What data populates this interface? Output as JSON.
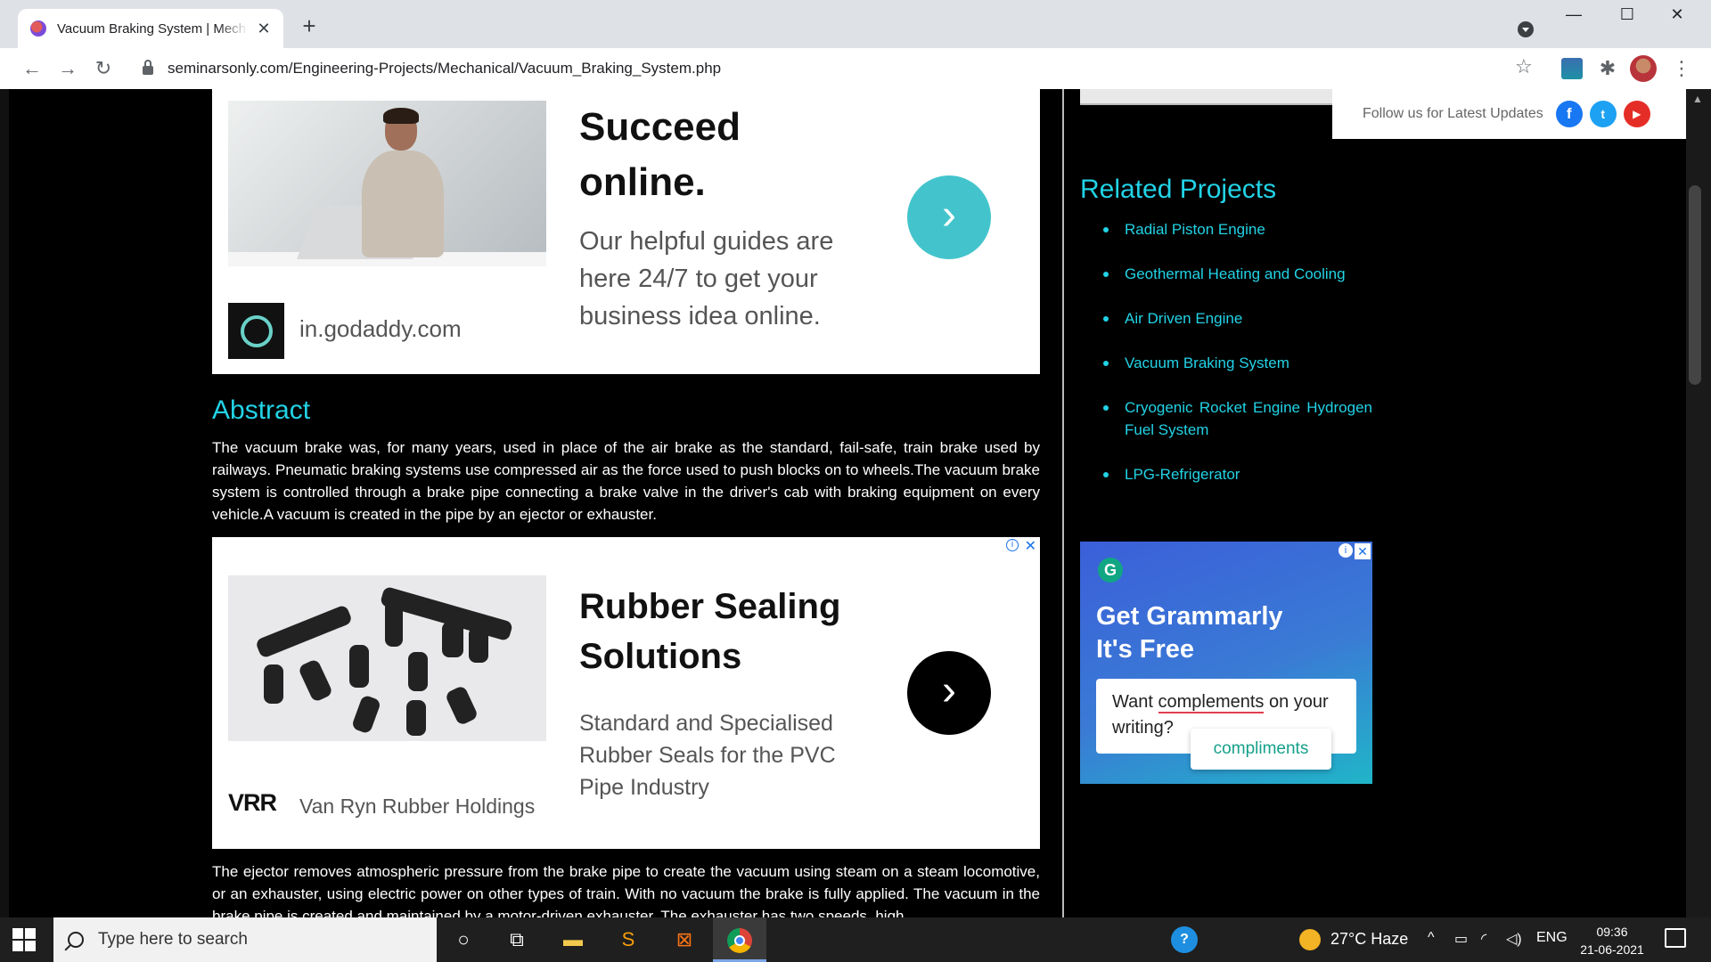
{
  "browser": {
    "tab_title": "Vacuum Braking System | Mechanical",
    "tab_close": "✕",
    "new_tab": "+",
    "url": "seminarsonly.com/Engineering-Projects/Mechanical/Vacuum_Braking_System.php",
    "window": {
      "minimize": "—",
      "maximize": "☐",
      "close": "✕"
    },
    "nav": {
      "back": "←",
      "forward": "→",
      "reload": "↻"
    },
    "star": "☆",
    "extensions": "✱",
    "menu": "⋮"
  },
  "ad_top": {
    "headline": "Succeed online.",
    "description": "Our helpful guides are here 24/7 to get your business idea online.",
    "domain": "in.godaddy.com",
    "cta": "›"
  },
  "abstract": {
    "title": "Abstract",
    "paragraph1": "The vacuum brake was, for many years, used in place of the air brake as the standard, fail-safe, train brake used by railways. Pneumatic braking systems use compressed air as the force used to push blocks on to wheels.The vacuum brake system is controlled through a brake pipe connecting a brake valve in the driver's cab with braking equipment on every vehicle.A vacuum is created in the pipe by an ejector or exhauster.",
    "paragraph2": "The ejector removes atmospheric pressure from the brake pipe to create the vacuum using steam on a steam locomotive, or an exhauster, using electric power on other types of train. With no vacuum the brake is fully applied. The vacuum in the brake pipe is created and maintained by a motor-driven exhauster. The exhauster has two speeds, high"
  },
  "ad_mid": {
    "headline": "Rubber Sealing Solutions",
    "description": "Standard and Specialised Rubber Seals for the PVC Pipe Industry",
    "logo": "VRR",
    "advertiser": "Van Ryn Rubber Holdings",
    "cta": "›",
    "adchoice": "i",
    "close": "✕"
  },
  "sidebar": {
    "follow_label": "Follow us for Latest Updates",
    "social": {
      "facebook": "f",
      "twitter": "t",
      "youtube": "▶"
    },
    "related_title": "Related Projects",
    "related": [
      "Radial Piston Engine",
      "Geothermal Heating and Cooling",
      "Air Driven Engine",
      "Vacuum Braking System",
      "Cryogenic Rocket Engine Hydrogen Fuel System",
      "LPG-Refrigerator"
    ]
  },
  "grammarly_ad": {
    "logo": "G",
    "title_line1": "Get Grammarly",
    "title_line2": "It's Free",
    "card_prefix": "Want ",
    "card_word": "complements",
    "card_suffix": " on your writing?",
    "suggestion": "compliments",
    "adchoice": "i",
    "close": "✕"
  },
  "taskbar": {
    "search_placeholder": "Type here to search",
    "help": "?",
    "weather": "27°C  Haze",
    "tray_arrow": "^",
    "language": "ENG",
    "time": "09:36",
    "date": "21-06-2021"
  },
  "colors": {
    "accent": "#22d3e6",
    "page_bg": "#000000"
  }
}
